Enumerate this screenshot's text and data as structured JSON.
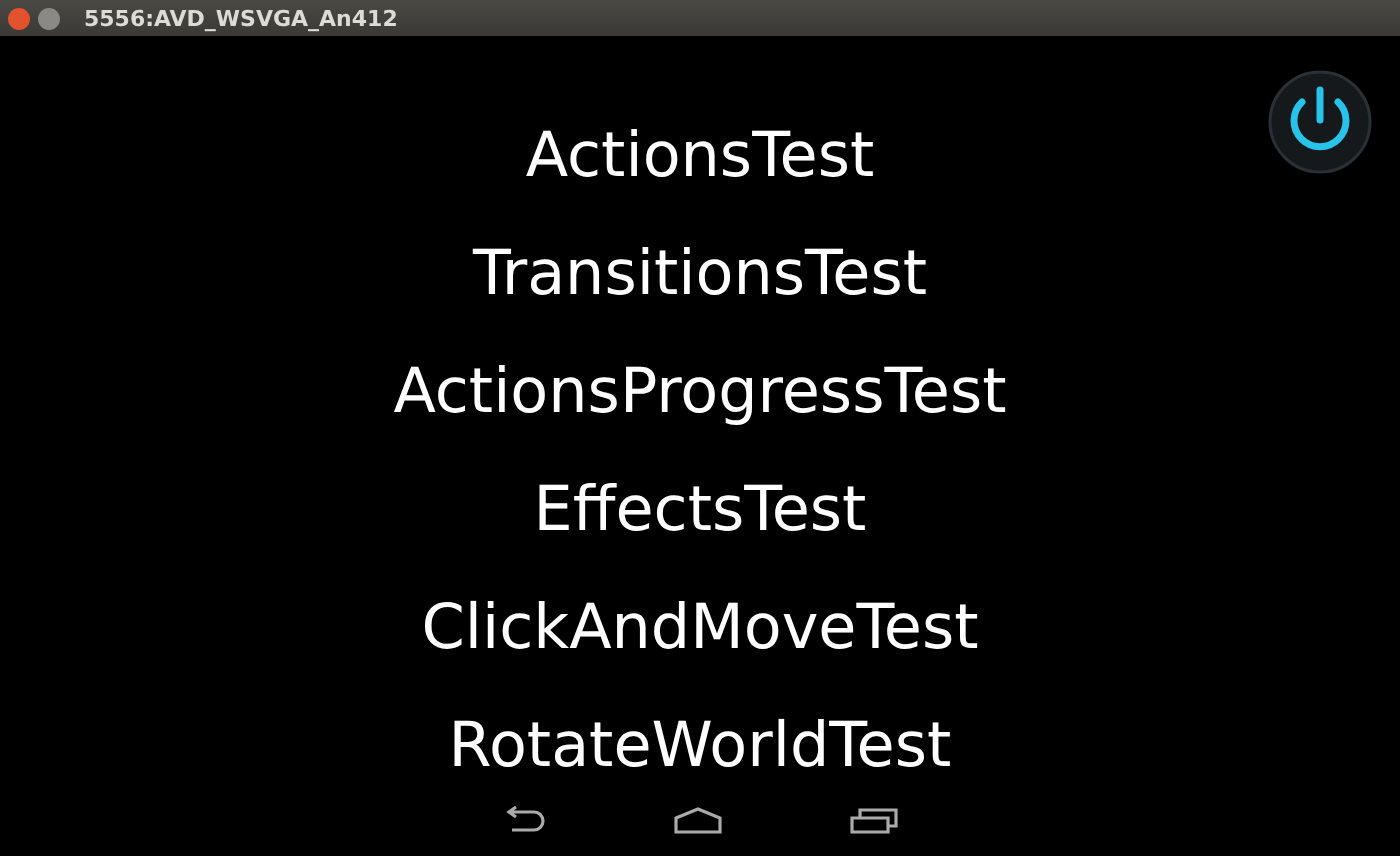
{
  "window": {
    "title": "5556:AVD_WSVGA_An412"
  },
  "menu_items": [
    "ActionsTest",
    "TransitionsTest",
    "ActionsProgressTest",
    "EffectsTest",
    "ClickAndMoveTest",
    "RotateWorldTest"
  ]
}
